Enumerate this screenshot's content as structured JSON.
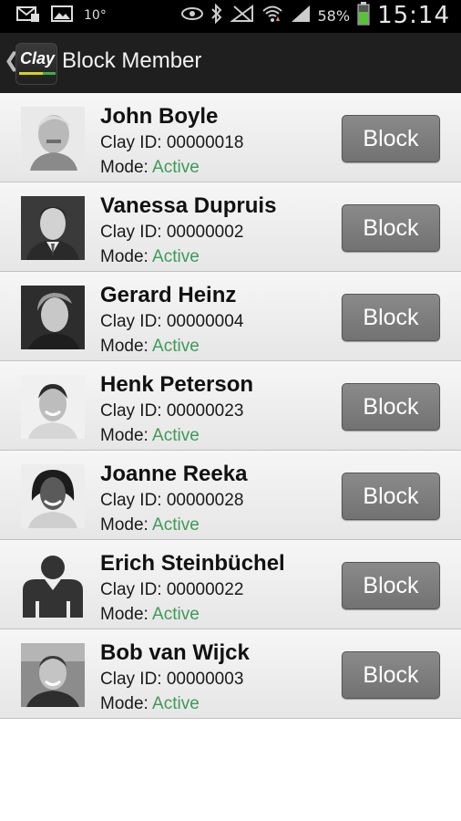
{
  "status_bar": {
    "left_icons": [
      "mail-icon",
      "image-icon"
    ],
    "temperature": "10°",
    "right_icons": [
      "eye-icon",
      "bluetooth-icon",
      "no-signal-icon",
      "wifi-icon",
      "cell-signal-icon"
    ],
    "battery_percent": "58%",
    "time": "15:14"
  },
  "action_bar": {
    "app_icon_text": "Clay",
    "title": "Block Member"
  },
  "members": [
    {
      "name": "John Boyle",
      "clay_id": "Clay ID: 00000018",
      "mode_label": "Mode:",
      "mode_value": "Active",
      "button": "Block",
      "avatar": "photo"
    },
    {
      "name": "Vanessa Dupruis",
      "clay_id": "Clay ID: 00000002",
      "mode_label": "Mode:",
      "mode_value": "Active",
      "button": "Block",
      "avatar": "photo"
    },
    {
      "name": "Gerard Heinz",
      "clay_id": "Clay ID: 00000004",
      "mode_label": "Mode:",
      "mode_value": "Active",
      "button": "Block",
      "avatar": "photo"
    },
    {
      "name": "Henk Peterson",
      "clay_id": "Clay ID: 00000023",
      "mode_label": "Mode:",
      "mode_value": "Active",
      "button": "Block",
      "avatar": "photo"
    },
    {
      "name": "Joanne Reeka",
      "clay_id": "Clay ID: 00000028",
      "mode_label": "Mode:",
      "mode_value": "Active",
      "button": "Block",
      "avatar": "photo"
    },
    {
      "name": "Erich Steinbüchel",
      "clay_id": "Clay ID: 00000022",
      "mode_label": "Mode:",
      "mode_value": "Active",
      "button": "Block",
      "avatar": "placeholder"
    },
    {
      "name": "Bob van Wijck",
      "clay_id": "Clay ID: 00000003",
      "mode_label": "Mode:",
      "mode_value": "Active",
      "button": "Block",
      "avatar": "photo"
    }
  ],
  "colors": {
    "active_green": "#3e9a57",
    "button_gray": "#7d7d7d",
    "action_bar": "#1f1f1f"
  }
}
